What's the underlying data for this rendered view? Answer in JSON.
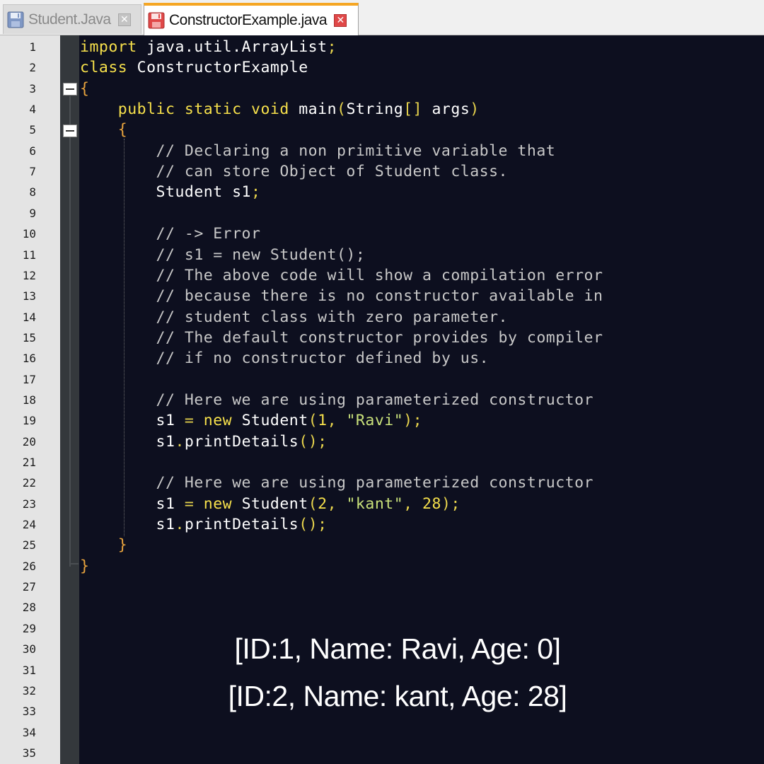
{
  "tabs": [
    {
      "label": "Student.Java",
      "active": false,
      "icon": "save-icon"
    },
    {
      "label": "ConstructorExample.java",
      "active": true,
      "icon": "save-icon-red"
    }
  ],
  "close_glyph": "✕",
  "line_numbers": [
    "1",
    "2",
    "3",
    "4",
    "5",
    "6",
    "7",
    "8",
    "9",
    "10",
    "11",
    "12",
    "13",
    "14",
    "15",
    "16",
    "17",
    "18",
    "19",
    "20",
    "21",
    "22",
    "23",
    "24",
    "25",
    "26",
    "27",
    "28",
    "29",
    "30",
    "31",
    "32",
    "33",
    "34",
    "35"
  ],
  "code_lines": [
    [
      {
        "t": "import",
        "c": "kw"
      },
      {
        "t": " java.util.ArrayList",
        "c": "id"
      },
      {
        "t": ";",
        "c": "op"
      }
    ],
    [
      {
        "t": "class",
        "c": "kw"
      },
      {
        "t": " ConstructorExample",
        "c": "id"
      }
    ],
    [
      {
        "t": "{",
        "c": "brace"
      }
    ],
    [
      {
        "t": "    public",
        "c": "kw"
      },
      {
        "t": " static",
        "c": "kw"
      },
      {
        "t": " void",
        "c": "kw"
      },
      {
        "t": " main",
        "c": "id"
      },
      {
        "t": "(",
        "c": "op"
      },
      {
        "t": "String",
        "c": "id"
      },
      {
        "t": "[]",
        "c": "op"
      },
      {
        "t": " args",
        "c": "id"
      },
      {
        "t": ")",
        "c": "op"
      }
    ],
    [
      {
        "t": "    {",
        "c": "brace"
      }
    ],
    [
      {
        "t": "        // Declaring a non primitive variable that",
        "c": "cm"
      }
    ],
    [
      {
        "t": "        // can store Object of Student class.",
        "c": "cm"
      }
    ],
    [
      {
        "t": "        Student s1",
        "c": "id"
      },
      {
        "t": ";",
        "c": "op"
      }
    ],
    [],
    [
      {
        "t": "        // -> Error",
        "c": "cm"
      }
    ],
    [
      {
        "t": "        // s1 = new Student();",
        "c": "cm"
      }
    ],
    [
      {
        "t": "        // The above code will show a compilation error",
        "c": "cm"
      }
    ],
    [
      {
        "t": "        // because there is no constructor available in",
        "c": "cm"
      }
    ],
    [
      {
        "t": "        // student class with zero parameter.",
        "c": "cm"
      }
    ],
    [
      {
        "t": "        // The default constructor provides by compiler",
        "c": "cm"
      }
    ],
    [
      {
        "t": "        // if no constructor defined by us.",
        "c": "cm"
      }
    ],
    [],
    [
      {
        "t": "        // Here we are using parameterized constructor",
        "c": "cm"
      }
    ],
    [
      {
        "t": "        s1 ",
        "c": "id"
      },
      {
        "t": "=",
        "c": "op"
      },
      {
        "t": " new",
        "c": "kw"
      },
      {
        "t": " Student",
        "c": "id"
      },
      {
        "t": "(",
        "c": "op"
      },
      {
        "t": "1",
        "c": "num"
      },
      {
        "t": ",",
        "c": "op"
      },
      {
        "t": " \"Ravi\"",
        "c": "str"
      },
      {
        "t": ");",
        "c": "op"
      }
    ],
    [
      {
        "t": "        s1",
        "c": "id"
      },
      {
        "t": ".",
        "c": "op"
      },
      {
        "t": "printDetails",
        "c": "id"
      },
      {
        "t": "();",
        "c": "op"
      }
    ],
    [],
    [
      {
        "t": "        // Here we are using parameterized constructor",
        "c": "cm"
      }
    ],
    [
      {
        "t": "        s1 ",
        "c": "id"
      },
      {
        "t": "=",
        "c": "op"
      },
      {
        "t": " new",
        "c": "kw"
      },
      {
        "t": " Student",
        "c": "id"
      },
      {
        "t": "(",
        "c": "op"
      },
      {
        "t": "2",
        "c": "num"
      },
      {
        "t": ",",
        "c": "op"
      },
      {
        "t": " \"kant\"",
        "c": "str"
      },
      {
        "t": ",",
        "c": "op"
      },
      {
        "t": " 28",
        "c": "num"
      },
      {
        "t": ");",
        "c": "op"
      }
    ],
    [
      {
        "t": "        s1",
        "c": "id"
      },
      {
        "t": ".",
        "c": "op"
      },
      {
        "t": "printDetails",
        "c": "id"
      },
      {
        "t": "();",
        "c": "op"
      }
    ],
    [
      {
        "t": "    }",
        "c": "brace"
      }
    ],
    [
      {
        "t": "}",
        "c": "brace"
      }
    ],
    [],
    [],
    [],
    [],
    [],
    [],
    [],
    [],
    []
  ],
  "output": {
    "line1": "[ID:1, Name: Ravi, Age: 0]",
    "line2": "[ID:2, Name: kant, Age: 28]"
  },
  "colors": {
    "editor_background": "#0d0f1f",
    "keyword": "#f6e04b",
    "comment": "#c8c8c8",
    "string": "#c8e07a",
    "active_tab_accent": "#f5a623"
  }
}
